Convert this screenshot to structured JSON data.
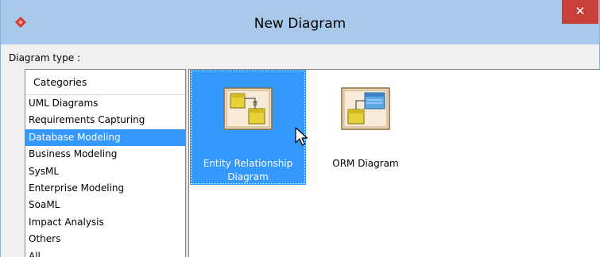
{
  "window": {
    "title": "New Diagram",
    "close_label": "✕"
  },
  "diagram_type_label": "Diagram type :",
  "categories": {
    "header": "Categories",
    "items": [
      {
        "label": "UML Diagrams"
      },
      {
        "label": "Requirements Capturing"
      },
      {
        "label": "Database Modeling"
      },
      {
        "label": "Business Modeling"
      },
      {
        "label": "SysML"
      },
      {
        "label": "Enterprise Modeling"
      },
      {
        "label": "SoaML"
      },
      {
        "label": "Impact Analysis"
      },
      {
        "label": "Others"
      },
      {
        "label": "All"
      }
    ],
    "selected": "Database Modeling"
  },
  "diagrams": [
    {
      "label": "Entity Relationship Diagram",
      "selected": true,
      "icon": "erd-thumbnail-icon"
    },
    {
      "label": "ORM Diagram",
      "selected": false,
      "icon": "orm-thumbnail-icon"
    }
  ],
  "colors": {
    "titlebar": "#a9c9ea",
    "selection": "#3399ff",
    "close": "#c7403a"
  }
}
